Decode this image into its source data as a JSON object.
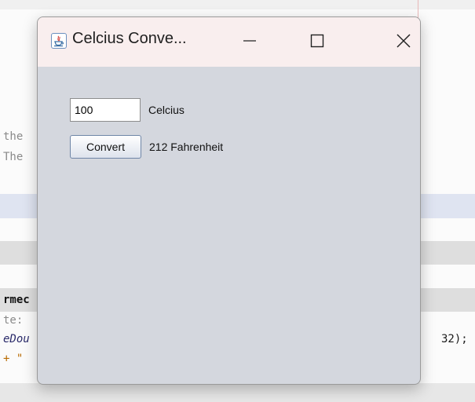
{
  "window": {
    "title": "Celcius Conve...",
    "titlebar_color": "#f9eeee",
    "body_color": "#d4d7de"
  },
  "form": {
    "input_value": "100",
    "unit_label": "Celcius",
    "convert_label": "Convert",
    "result_label": "212 Fahrenheit"
  },
  "background_code": {
    "line1": "the",
    "line2": "The",
    "line3": "rmec",
    "line4": "te:",
    "line5_left": "eDou",
    "line5_right": "32);",
    "line6": "+ \""
  },
  "icons": [
    "java-app-icon",
    "minimize-icon",
    "maximize-icon",
    "close-icon"
  ]
}
